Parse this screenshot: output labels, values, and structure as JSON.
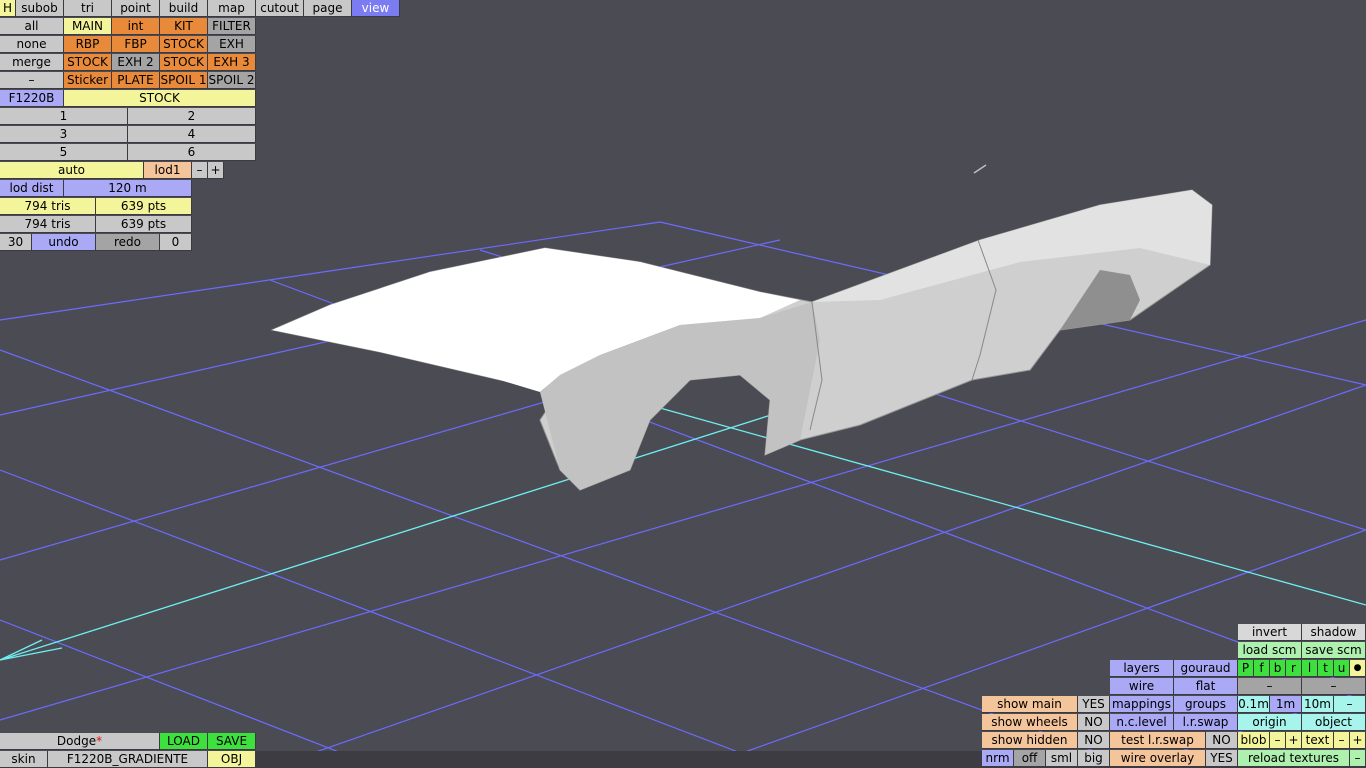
{
  "menu": {
    "h": "H",
    "subob": "subob",
    "tri": "tri",
    "point": "point",
    "build": "build",
    "map": "map",
    "cutout": "cutout",
    "page": "page",
    "view": "view"
  },
  "left": {
    "all": "all",
    "none": "none",
    "merge": "merge",
    "dash": "–",
    "r1": [
      "MAIN",
      "int",
      "KIT",
      "FILTER"
    ],
    "r2": [
      "RBP",
      "FBP",
      "STOCK",
      "EXH"
    ],
    "r3": [
      "STOCK",
      "EXH 2",
      "STOCK",
      "EXH 3"
    ],
    "r4": [
      "Sticker",
      "PLATE",
      "SPOIL 1",
      "SPOIL 2"
    ],
    "model_code": "F1220B",
    "stock_label": "STOCK",
    "nums": [
      "1",
      "2",
      "3",
      "4",
      "5",
      "6"
    ],
    "auto": "auto",
    "lod": "lod1",
    "minus": "–",
    "plus": "+",
    "lod_dist_label": "lod dist",
    "lod_dist_value": "120 m",
    "tris1": "794 tris",
    "pts1": "639 pts",
    "tris2": "794 tris",
    "pts2": "639 pts",
    "undo_count": "30",
    "undo": "undo",
    "redo": "redo",
    "redo_count": "0"
  },
  "bottom_left": {
    "car_name": "Dodge",
    "modified_mark": "*",
    "load": "LOAD",
    "save": "SAVE",
    "skin": "skin",
    "skin_value": "F1220B_GRADIENTE",
    "obj": "OBJ"
  },
  "right": {
    "invert": "invert",
    "shadow": "shadow",
    "load_scm": "load scm",
    "save_scm": "save scm",
    "layers": "layers",
    "gouraud": "gouraud",
    "views": [
      "P",
      "f",
      "b",
      "r",
      "l",
      "t",
      "u"
    ],
    "dot": "●",
    "wire": "wire",
    "flat": "flat",
    "dash1": "–",
    "dash2": "–",
    "show_main": "show main",
    "show_main_v": "YES",
    "show_wheels": "show wheels",
    "show_wheels_v": "NO",
    "show_hidden": "show hidden",
    "show_hidden_v": "NO",
    "mappings": "mappings",
    "groups": "groups",
    "m01": "0.1m",
    "m1": "1m",
    "m10": "10m",
    "mdash": "–",
    "nclevel": "n.c.level",
    "lrswap": "l.r.swap",
    "origin": "origin",
    "object": "object",
    "test_lrswap": "test l.r.swap",
    "test_lrswap_v": "NO",
    "blob": "blob",
    "blob_minus": "–",
    "blob_plus": "+",
    "text": "text",
    "text_minus": "–",
    "text_plus": "+",
    "nrm": "nrm",
    "off": "off",
    "sml": "sml",
    "big": "big",
    "wire_overlay": "wire overlay",
    "wire_overlay_v": "YES",
    "reload_textures": "reload textures",
    "reload_dash": "–"
  }
}
